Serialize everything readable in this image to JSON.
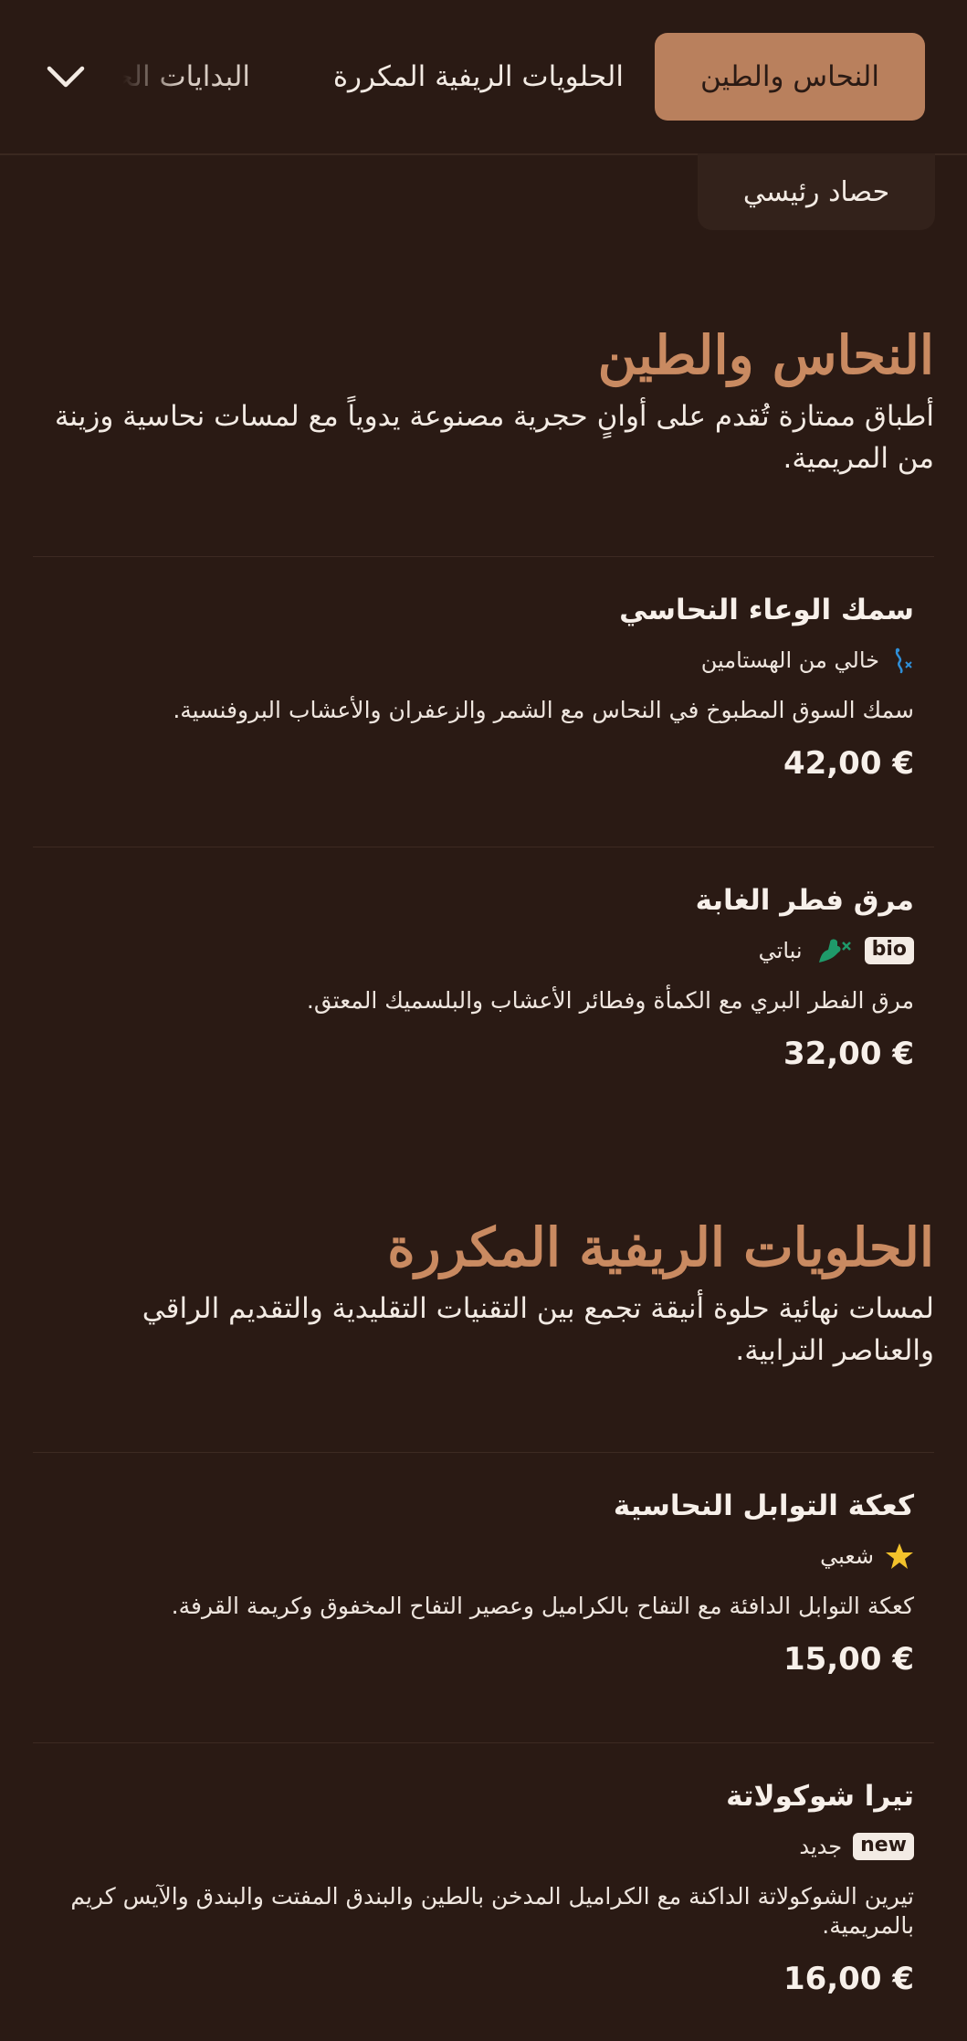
{
  "nav": {
    "tabs": [
      {
        "label": "النحاس والطين",
        "active": true
      },
      {
        "label": "الحلويات الريفية المكررة",
        "active": false
      },
      {
        "label": "البدايات الحرفية",
        "active": false
      }
    ],
    "more_icon": "chevron-down-icon",
    "subcategory": "حصاد رئيسي"
  },
  "colors": {
    "background": "#2a1a14",
    "accent": "#b9805d",
    "heading": "#c98a61",
    "histamine_icon": "#2f8fd8",
    "vegan_icon": "#1f9a6a",
    "star": "#f3c22b"
  },
  "sections": [
    {
      "title": "النحاس والطين",
      "description": "أطباق ممتازة تُقدم على أوانٍ حجرية مصنوعة يدوياً مع لمسات نحاسية وزينة من المريمية.",
      "items": [
        {
          "name": "سمك الوعاء النحاسي",
          "tags": [
            {
              "icon": "histamine-free-icon",
              "label": "خالي من الهستامين"
            }
          ],
          "description": "سمك السوق المطبوخ في النحاس مع الشمر والزعفران والأعشاب البروفنسية.",
          "price": "42,00 €"
        },
        {
          "name": "مرق فطر الغابة",
          "badge": "bio",
          "tags": [
            {
              "icon": "vegan-icon",
              "label": "نباتي"
            }
          ],
          "description": "مرق الفطر البري مع الكمأة وفطائر الأعشاب والبلسميك المعتق.",
          "price": "32,00 €"
        }
      ]
    },
    {
      "title": "الحلويات الريفية المكررة",
      "description": "لمسات نهائية حلوة أنيقة تجمع بين التقنيات التقليدية والتقديم الراقي والعناصر الترابية.",
      "items": [
        {
          "name": "كعكة التوابل النحاسية",
          "tags": [
            {
              "icon": "star-icon",
              "label": "شعبي"
            }
          ],
          "description": "كعكة التوابل الدافئة مع التفاح بالكراميل وعصير التفاح المخفوق وكريمة القرفة.",
          "price": "15,00 €"
        },
        {
          "name": "تيرا شوكولاتة",
          "badge": "new",
          "tags": [
            {
              "label": "جديد"
            }
          ],
          "description": "تيرين الشوكولاتة الداكنة مع الكراميل المدخن بالطين والبندق المفتت والبندق والآيس كريم بالمريمية.",
          "price": "16,00 €"
        }
      ]
    }
  ]
}
